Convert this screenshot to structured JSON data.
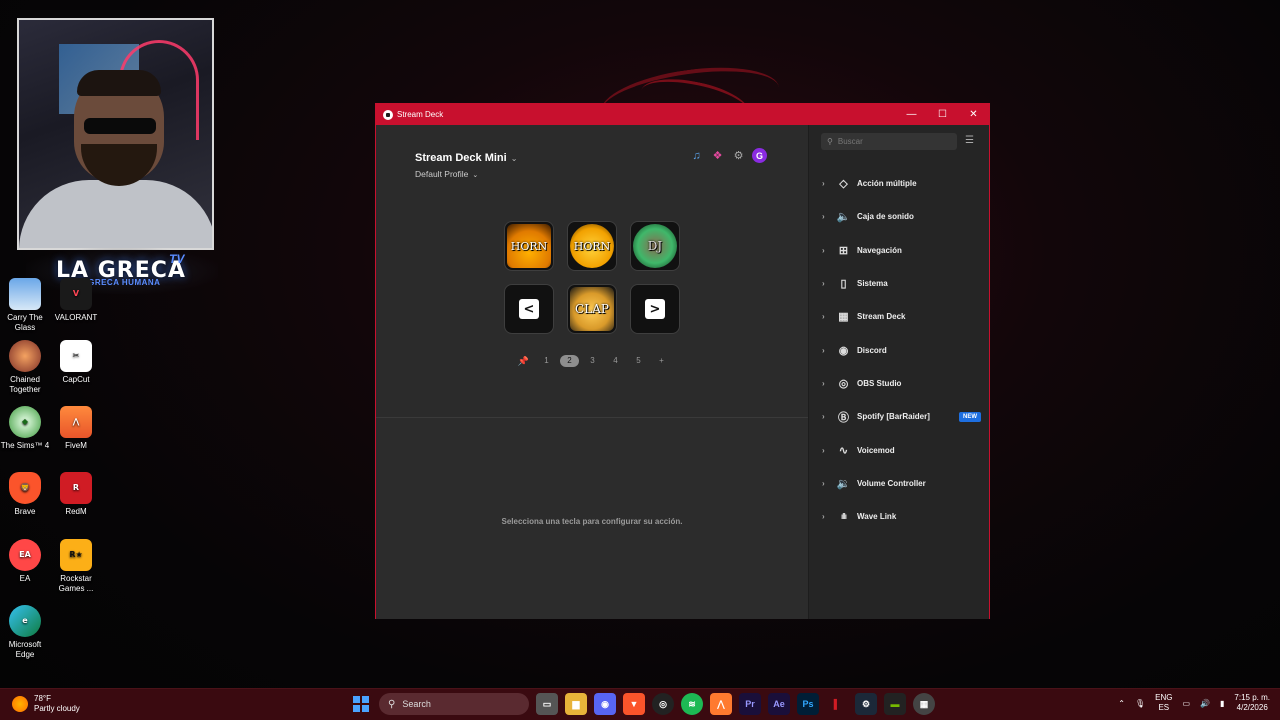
{
  "desktop": {
    "webcam_logo": "LA GRECA",
    "webcam_logo_tv": "TV",
    "webcam_logo_sub": "LA GRECA HUMANA",
    "icons": [
      {
        "label": "Carry The Glass",
        "icon": "carry-the-glass-icon"
      },
      {
        "label": "VALORANT",
        "icon": "valorant-icon"
      },
      {
        "label": "Chained Together",
        "icon": "chained-together-icon"
      },
      {
        "label": "CapCut",
        "icon": "capcut-icon"
      },
      {
        "label": "The Sims™ 4",
        "icon": "sims4-icon"
      },
      {
        "label": "FiveM",
        "icon": "fivem-icon"
      },
      {
        "label": "Brave",
        "icon": "brave-icon"
      },
      {
        "label": "RedM",
        "icon": "redm-icon"
      },
      {
        "label": "EA",
        "icon": "ea-icon"
      },
      {
        "label": "Rockstar Games ...",
        "icon": "rockstar-icon"
      },
      {
        "label": "Microsoft Edge",
        "icon": "edge-icon"
      }
    ]
  },
  "window": {
    "title": "Stream Deck",
    "accent": "#c8102e",
    "controls": {
      "minimize": "—",
      "maximize": "☐",
      "close": "✕"
    }
  },
  "main": {
    "device_name": "Stream Deck Mini",
    "profile_name": "Default Profile",
    "avatar_letter": "G",
    "keys": [
      {
        "label": "HORN",
        "style": "k-horn1"
      },
      {
        "label": "HORN",
        "style": "k-horn2"
      },
      {
        "label": "DJ",
        "style": "k-dj"
      },
      {
        "label": "<",
        "style": "k-nav"
      },
      {
        "label": "CLAP",
        "style": "k-clap"
      },
      {
        "label": ">",
        "style": "k-nav"
      }
    ],
    "pages": [
      "1",
      "2",
      "3",
      "4",
      "5"
    ],
    "active_page": "2",
    "add_page": "+",
    "hint": "Selecciona una tecla para configurar su acción."
  },
  "sidebar": {
    "search_placeholder": "Buscar",
    "categories": [
      {
        "label": "Acción múltiple",
        "icon": "multi-action-icon",
        "glyph": "◇"
      },
      {
        "label": "Caja de sonido",
        "icon": "speaker-icon",
        "glyph": "🔈"
      },
      {
        "label": "Navegación",
        "icon": "navigation-icon",
        "glyph": "⊞"
      },
      {
        "label": "Sistema",
        "icon": "system-icon",
        "glyph": "▯"
      },
      {
        "label": "Stream Deck",
        "icon": "stream-deck-icon",
        "glyph": "▦"
      },
      {
        "label": "Discord",
        "icon": "discord-icon",
        "glyph": "◉"
      },
      {
        "label": "OBS Studio",
        "icon": "obs-icon",
        "glyph": "◎"
      },
      {
        "label": "Spotify [BarRaider]",
        "icon": "barraider-icon",
        "glyph": "Ⓑ",
        "badge": "NEW"
      },
      {
        "label": "Voicemod",
        "icon": "voicemod-icon",
        "glyph": "∿"
      },
      {
        "label": "Volume Controller",
        "icon": "volume-controller-icon",
        "glyph": "🔉"
      },
      {
        "label": "Wave Link",
        "icon": "wave-link-icon",
        "glyph": "ıllı"
      }
    ]
  },
  "taskbar": {
    "temperature": "78°F",
    "weather": "Partly cloudy",
    "search_label": "Search",
    "lang_top": "ENG",
    "lang_bottom": "ES",
    "time": "7:15 p. m.",
    "date": "4/2/2026"
  }
}
